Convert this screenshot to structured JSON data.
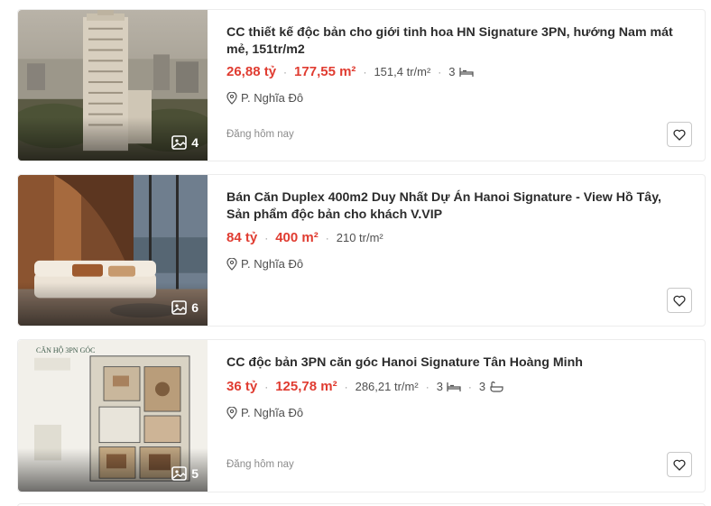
{
  "listings": [
    {
      "title": "CC thiết kế độc bản cho giới tinh hoa HN Signature 3PN, hướng Nam mát mẻ, 151tr/m2",
      "price": "26,88 tỷ",
      "area": "177,55 m²",
      "price_per_m2": "151,4 tr/m²",
      "bedrooms": "3",
      "bathrooms": "",
      "location": "P. Nghĩa Đô",
      "posted": "Đăng hôm nay",
      "photo_count": "4",
      "thumbnail_icon": "building-tower-photo"
    },
    {
      "title": "Bán Căn Duplex 400m2 Duy Nhất Dự Án Hanoi Signature - View Hồ Tây, Sản phẩm độc bản cho khách V.VIP",
      "price": "84 tỷ",
      "area": "400 m²",
      "price_per_m2": "210 tr/m²",
      "bedrooms": "",
      "bathrooms": "",
      "location": "P. Nghĩa Đô",
      "posted": "",
      "photo_count": "6",
      "thumbnail_icon": "living-room-photo"
    },
    {
      "title": "CC độc bản 3PN căn góc Hanoi Signature Tân Hoàng Minh",
      "price": "36 tỷ",
      "area": "125,78 m²",
      "price_per_m2": "286,21 tr/m²",
      "bedrooms": "3",
      "bathrooms": "3",
      "location": "P. Nghĩa Đô",
      "posted": "Đăng hôm nay",
      "photo_count": "5",
      "thumbnail_icon": "floor-plan-photo",
      "thumbnail_caption": "CĂN HỘ 3PN GÓC"
    }
  ],
  "colors": {
    "accent_price": "#e03c31",
    "title_text": "#2c2c2c",
    "secondary_text": "#505050",
    "muted_text": "#8c8c8c"
  }
}
